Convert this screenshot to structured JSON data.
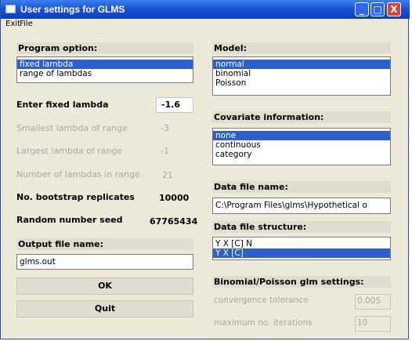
{
  "window": {
    "title": "User settings for GLMS",
    "minimize_glyph": "_",
    "maximize_glyph": "□",
    "close_glyph": "X",
    "icon": "app-window-icon"
  },
  "menu": {
    "exit_label": "Exit",
    "file_label": "File"
  },
  "program_option": {
    "label": "Program option:",
    "items": [
      {
        "label": "fixed lambda",
        "selected": true
      },
      {
        "label": "range of lambdas",
        "selected": false
      }
    ]
  },
  "lambda": {
    "fixed_label": "Enter fixed lambda",
    "fixed_value": "-1.6",
    "smallest_label": "Smallest lambda of range",
    "smallest_value": "-3",
    "largest_label": "Largest lambda of range",
    "largest_value": "-1",
    "number_label": "Number of lambdas in range",
    "number_value": "21"
  },
  "bootstrap": {
    "label": "No. bootstrap replicates",
    "value": "10000"
  },
  "seed": {
    "label": "Random number seed",
    "value": "67765434"
  },
  "output": {
    "label": "Output file name:",
    "value": "glms.out"
  },
  "buttons": {
    "ok_label": "OK",
    "quit_label": "Quit"
  },
  "model": {
    "label": "Model:",
    "items": [
      {
        "label": "normal",
        "selected": true
      },
      {
        "label": "binomial",
        "selected": false
      },
      {
        "label": "Poisson",
        "selected": false
      }
    ]
  },
  "covariate": {
    "label": "Covariate information:",
    "items": [
      {
        "label": "none",
        "selected": true
      },
      {
        "label": "continuous",
        "selected": false
      },
      {
        "label": "category",
        "selected": false
      }
    ]
  },
  "data_file": {
    "label": "Data file name:",
    "value": "C:\\Program Files\\glms\\Hypothetical o"
  },
  "data_structure": {
    "label": "Data file structure:",
    "items": [
      {
        "label": "Y X [C] N",
        "selected": false
      },
      {
        "label": "Y X [C]",
        "selected": true
      }
    ]
  },
  "glm_settings": {
    "label": "Binomial/Poisson glm settings:",
    "convergence_label": "convergence tolerance",
    "convergence_value": "0.005",
    "iterations_label": "maximum no. iterations",
    "iterations_value": "10"
  },
  "colors": {
    "selection": "#2e5fcf",
    "titlebar": "#1a55d6",
    "window_bg": "#ece9d8",
    "disabled_text": "#aaa9a0"
  }
}
